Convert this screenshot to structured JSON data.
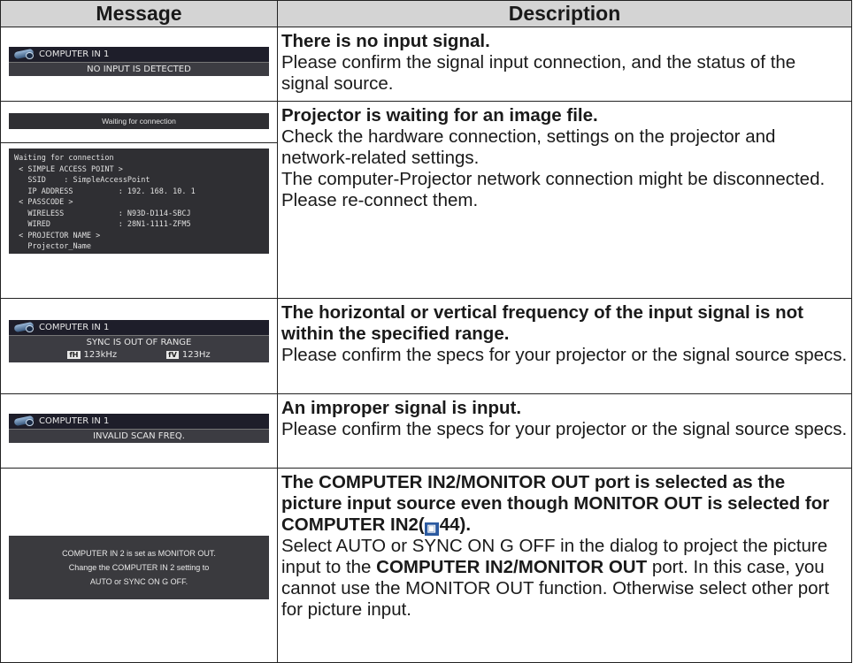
{
  "table": {
    "header": {
      "message": "Message",
      "description": "Description"
    },
    "rows": [
      {
        "osd": {
          "source": "COMPUTER IN 1",
          "text": "NO INPUT IS DETECTED"
        },
        "title": "There is no input signal.",
        "body": "Please confirm the signal input connection, and the status of the signal source."
      },
      {
        "waiting": "Waiting for connection",
        "info": "Waiting for connection\n < SIMPLE ACCESS POINT >\n   SSID    : SimpleAccessPoint\n   IP ADDRESS          : 192. 168. 10. 1\n < PASSCODE >\n   WIRELESS            : N93D-D114-SBCJ\n   WIRED               : 28N1-1111-ZFM5\n < PROJECTOR NAME >\n   Projector_Name",
        "title": "Projector is waiting for an image file.",
        "body": "Check the hardware connection, settings on the projector and network-related settings.\nThe computer-Projector network connection might be disconnected. Please re-connect them."
      },
      {
        "osd": {
          "source": "COMPUTER IN 1",
          "text": "SYNC IS OUT OF RANGE",
          "fh_tag": "fH",
          "fh": "123kHz",
          "fv_tag": "fV",
          "fv": "123Hz"
        },
        "title": "The horizontal or vertical frequency of the input signal is not within the specified range.",
        "body": "Please confirm the specs for your projector or the signal source specs."
      },
      {
        "osd": {
          "source": "COMPUTER IN 1",
          "text": "INVALID SCAN FREQ."
        },
        "title": "An improper signal is input.",
        "body": "Please confirm the specs for your projector or the signal source specs."
      },
      {
        "dialog": [
          "COMPUTER IN 2 is set as MONITOR OUT.",
          "Change the COMPUTER IN 2 setting to",
          "AUTO or SYNC ON G OFF."
        ],
        "title_a": "The COMPUTER IN2/MONITOR OUT port is selected as the picture input source even though MONITOR OUT is selected for COMPUTER IN2(",
        "ref_page": "44",
        "title_b": ").",
        "body_a": "Select AUTO or SYNC ON G OFF in the dialog to project the picture input to the ",
        "body_bold": "COMPUTER IN2/MONITOR OUT",
        "body_b": " port. In this case, you cannot use the MONITOR OUT function. Otherwise select other port for picture input."
      }
    ]
  }
}
